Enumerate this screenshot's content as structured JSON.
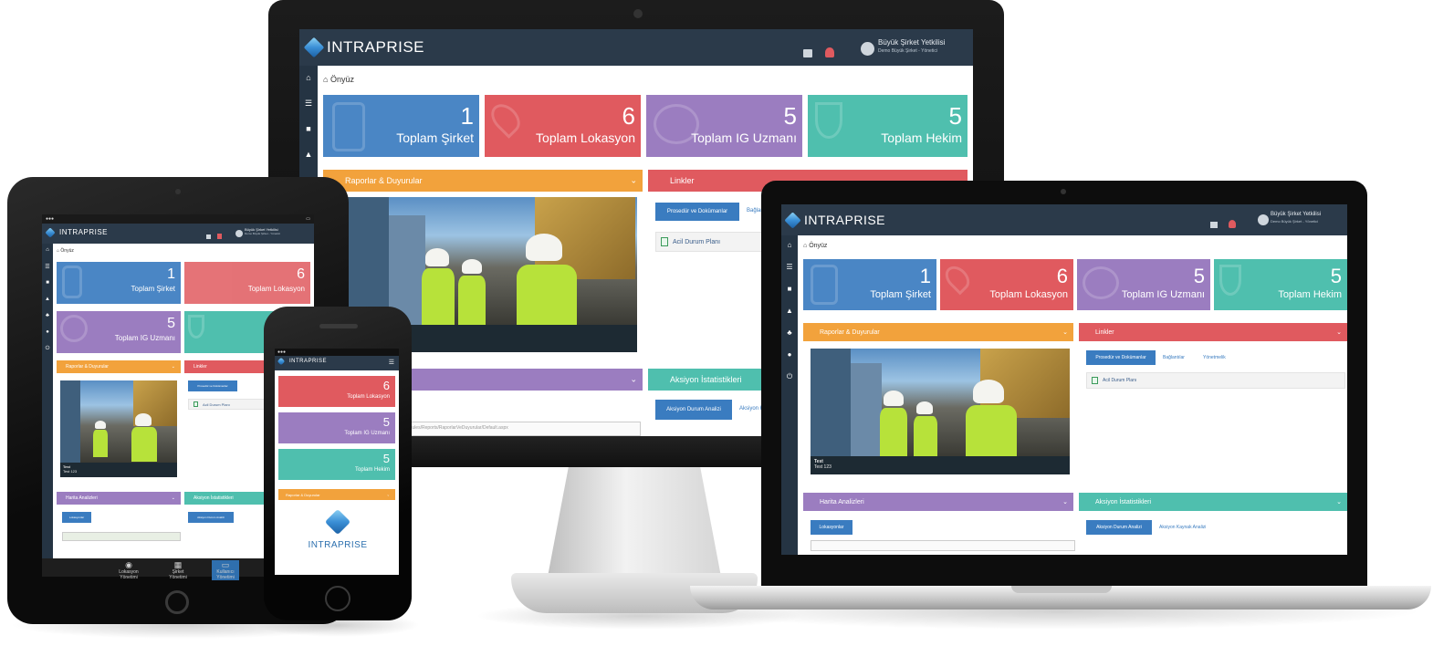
{
  "app": {
    "logo": "INTRAPRISE",
    "user_name": "Büyük Şirket Yetkilisi",
    "user_role": "Demo Büyük Şirket - Yönetici",
    "breadcrumb": "Önyüz"
  },
  "tiles": [
    {
      "count": "1",
      "label": "Toplam Şirket",
      "color": "#4a86c5"
    },
    {
      "count": "6",
      "label": "Toplam Lokasyon",
      "color": "#e05a5f"
    },
    {
      "count": "5",
      "label": "Toplam IG Uzmanı",
      "color": "#9b7dc0"
    },
    {
      "count": "5",
      "label": "Toplam Hekim",
      "color": "#4fbfae"
    }
  ],
  "panels": {
    "reports": {
      "title": "Raporlar & Duyurular",
      "color": "#f2a23c"
    },
    "links": {
      "title": "Linkler",
      "color": "#e05a5f"
    },
    "map": {
      "title": "Harita Analizleri",
      "color": "#9b7dc0"
    },
    "actions": {
      "title": "Aksiyon İstatistikleri",
      "color": "#4fbfae"
    }
  },
  "photo_caption": {
    "title": "Test",
    "subtitle": "Test 123"
  },
  "links_panel": {
    "tab_active": "Prosedür ve Dokümanlar",
    "tab_2": "Bağlantılar",
    "tab_3": "Yönetmelik",
    "file": "Acil Durum Planı"
  },
  "map_panel": {
    "button": "Lokasyonlar"
  },
  "actions_panel": {
    "button": "Aksiyon Durum Analizi",
    "link": "Aksiyon Kaynak Analizi"
  },
  "phone_logo_big": "INTRAPRISE",
  "tablet_dock": [
    "Lokasyon Yönetimi",
    "Şirket Yönetimi",
    "Kullanıcı Yönetimi"
  ],
  "url_text": "https://demo.intraprise.com/Modules/Reports/RaporlarVeDuyurular/Default.aspx"
}
